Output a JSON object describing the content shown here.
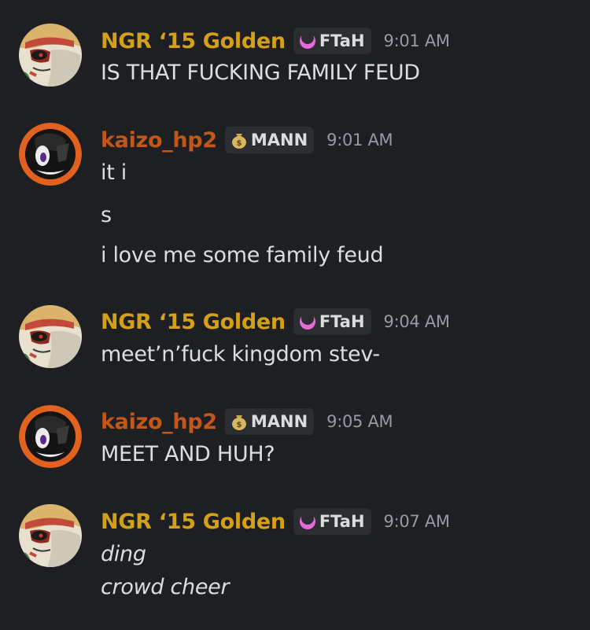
{
  "colors": {
    "background": "#1e1f22",
    "ngr_name": "#d4a017",
    "kaizo_name": "#c2571a",
    "text": "#dbdee1",
    "timestamp": "#949ba4",
    "tag_bg": "#2b2d31"
  },
  "messages": [
    {
      "author": "NGR ‘15 Golden",
      "tag": "FTaH",
      "tag_icon": "pink-crescent-icon",
      "time": "9:01 AM",
      "lines": [
        "IS THAT FUCKING FAMILY FEUD"
      ]
    },
    {
      "author": "kaizo_hp2",
      "tag": "MANN",
      "tag_icon": "money-bag-icon",
      "time": "9:01 AM",
      "lines": [
        "it i",
        "s",
        "i love me some family feud"
      ]
    },
    {
      "author": "NGR ‘15 Golden",
      "tag": "FTaH",
      "tag_icon": "pink-crescent-icon",
      "time": "9:04 AM",
      "lines": [
        "meet’n’fuck kingdom stev-"
      ]
    },
    {
      "author": "kaizo_hp2",
      "tag": "MANN",
      "tag_icon": "money-bag-icon",
      "time": "9:05 AM",
      "lines": [
        "MEET AND HUH?"
      ]
    },
    {
      "author": "NGR ‘15 Golden",
      "tag": "FTaH",
      "tag_icon": "pink-crescent-icon",
      "time": "9:07 AM",
      "lines": [
        "ding",
        "crowd cheer"
      ]
    }
  ]
}
